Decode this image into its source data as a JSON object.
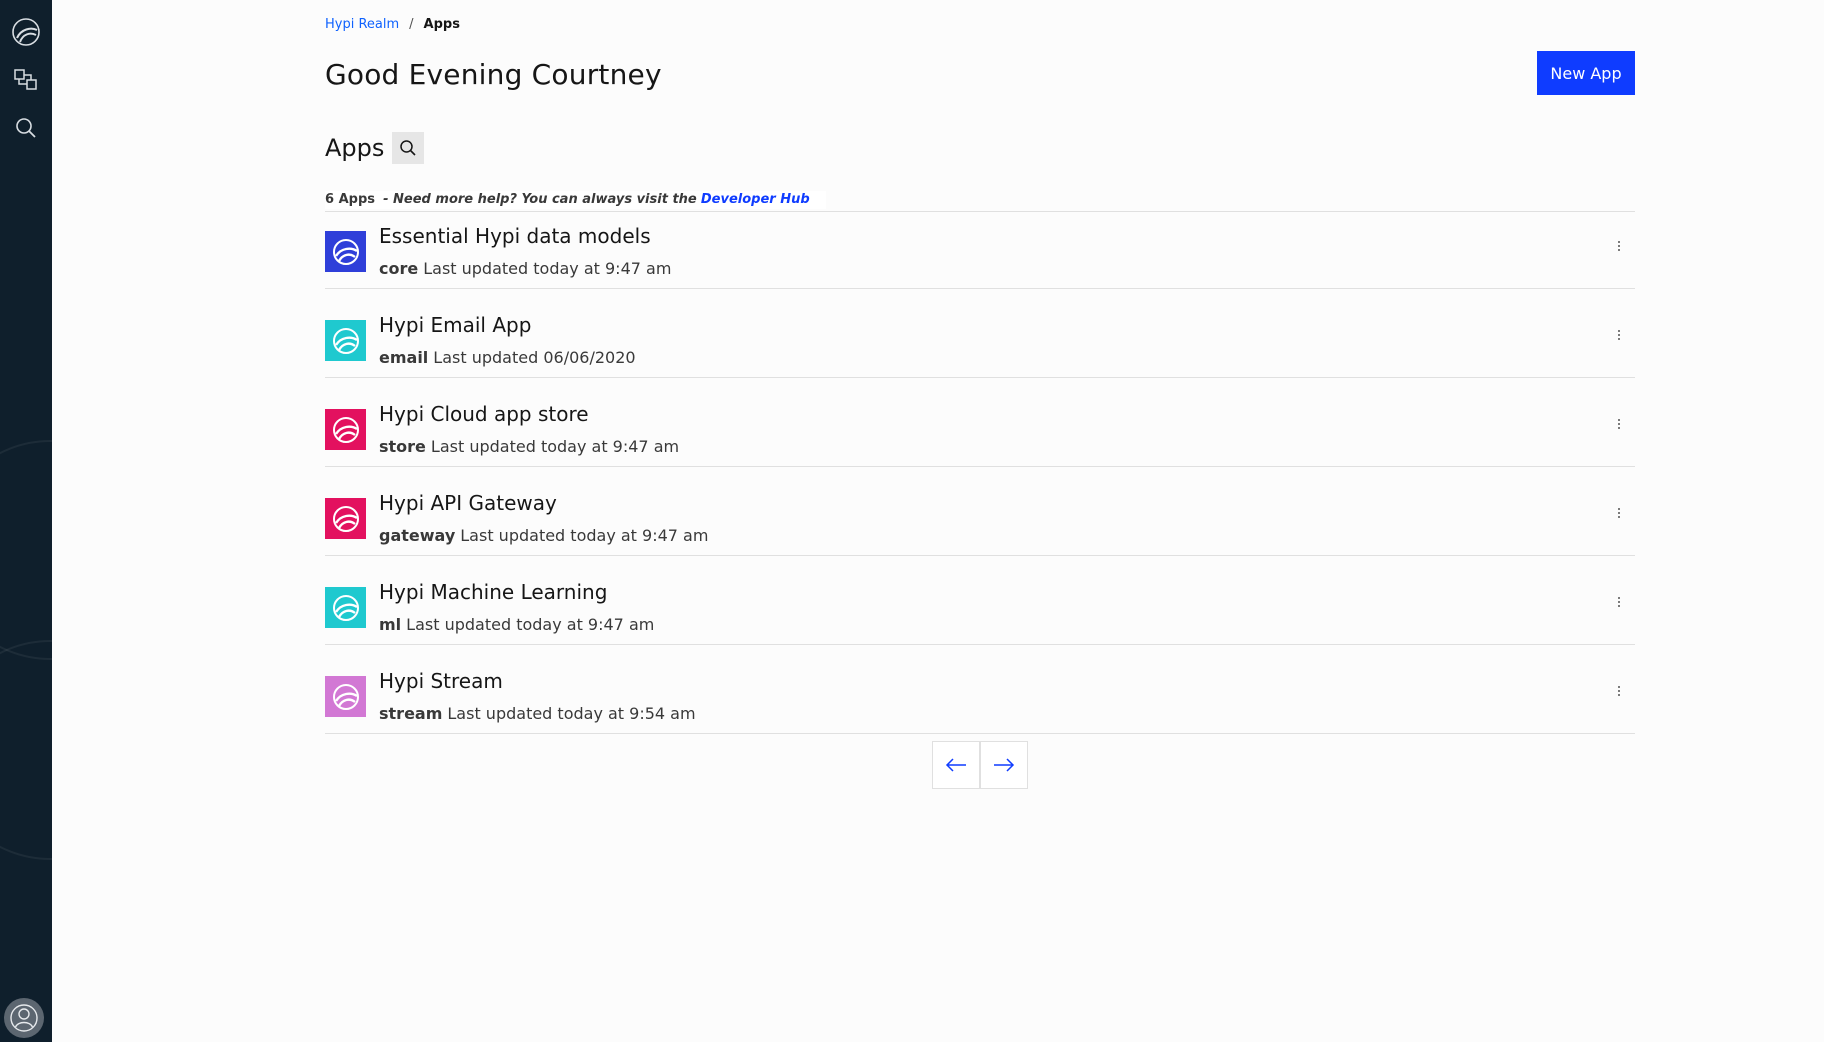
{
  "breadcrumb": {
    "realm": "Hypi Realm",
    "separator": "/",
    "current": "Apps"
  },
  "greeting": "Good Evening Courtney",
  "new_app_label": "New App",
  "apps_heading": "Apps",
  "summary": {
    "count": "6 Apps",
    "help": "- Need more help? You can always visit the",
    "hub_link": "Developer Hub"
  },
  "apps": [
    {
      "name": "Essential Hypi data models",
      "key": "core",
      "updated": "Last updated today at 9:47 am",
      "icon_color": "#2f3fd9"
    },
    {
      "name": "Hypi Email App",
      "key": "email",
      "updated": "Last updated 06/06/2020",
      "icon_color": "#1fc9cf"
    },
    {
      "name": "Hypi Cloud app store",
      "key": "store",
      "updated": "Last updated today at 9:47 am",
      "icon_color": "#e3115f"
    },
    {
      "name": "Hypi API Gateway",
      "key": "gateway",
      "updated": "Last updated today at 9:47 am",
      "icon_color": "#e3115f"
    },
    {
      "name": "Hypi Machine Learning",
      "key": "ml",
      "updated": "Last updated today at 9:47 am",
      "icon_color": "#1fc9cf"
    },
    {
      "name": "Hypi Stream",
      "key": "stream",
      "updated": "Last updated today at 9:54 am",
      "icon_color": "#d278d4"
    }
  ],
  "colors": {
    "sidebar": "#0f1f2c",
    "accent": "#0f3cff",
    "link": "#0f62fe"
  }
}
